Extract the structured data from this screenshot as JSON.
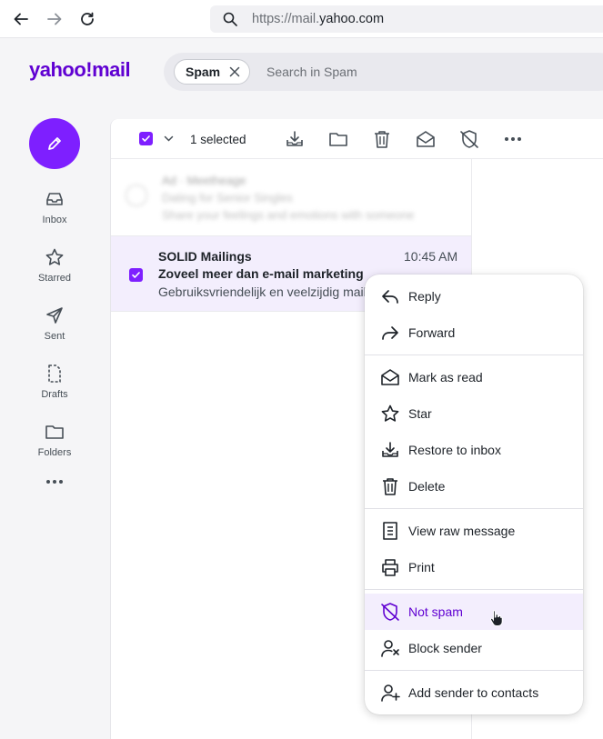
{
  "browser": {
    "url_prefix": "https://mail.",
    "url_domain": "yahoo.com",
    "back_icon": "arrow-left-icon",
    "forward_icon": "arrow-right-icon",
    "reload_icon": "reload-icon"
  },
  "header": {
    "logo": "yahoo!mail",
    "search_chip": "Spam",
    "search_placeholder": "Search in Spam"
  },
  "sidebar": {
    "items": [
      {
        "label": "Inbox",
        "icon": "inbox-icon"
      },
      {
        "label": "Starred",
        "icon": "star-icon"
      },
      {
        "label": "Sent",
        "icon": "send-icon"
      },
      {
        "label": "Drafts",
        "icon": "drafts-icon"
      },
      {
        "label": "Folders",
        "icon": "folder-icon"
      }
    ]
  },
  "toolbar": {
    "selected_text": "1 selected"
  },
  "ad": {
    "label": "Ad · Meetheage",
    "title": "Dating for Senior Singles",
    "desc": "Share your feelings and emotions with someone"
  },
  "message": {
    "sender": "SOLID Mailings",
    "time": "10:45 AM",
    "subject": "Zoveel meer dan e-mail marketing",
    "preview": "Gebruiksvriendelijk en veelzijdig mail"
  },
  "context_menu": {
    "items": [
      {
        "label": "Reply",
        "icon": "reply-icon"
      },
      {
        "label": "Forward",
        "icon": "forward-icon"
      },
      {
        "label": "Mark as read",
        "icon": "envelope-open-icon"
      },
      {
        "label": "Star",
        "icon": "star-icon"
      },
      {
        "label": "Restore to inbox",
        "icon": "restore-inbox-icon"
      },
      {
        "label": "Delete",
        "icon": "trash-icon"
      },
      {
        "label": "View raw message",
        "icon": "document-icon"
      },
      {
        "label": "Print",
        "icon": "printer-icon"
      },
      {
        "label": "Not spam",
        "icon": "not-spam-shield-icon"
      },
      {
        "label": "Block sender",
        "icon": "block-user-icon"
      },
      {
        "label": "Add sender to contacts",
        "icon": "add-contact-icon"
      }
    ],
    "active_item": "Not spam"
  },
  "colors": {
    "accent": "#7e1fff",
    "brand": "#6001d2",
    "selected_row": "#f3eefd"
  }
}
